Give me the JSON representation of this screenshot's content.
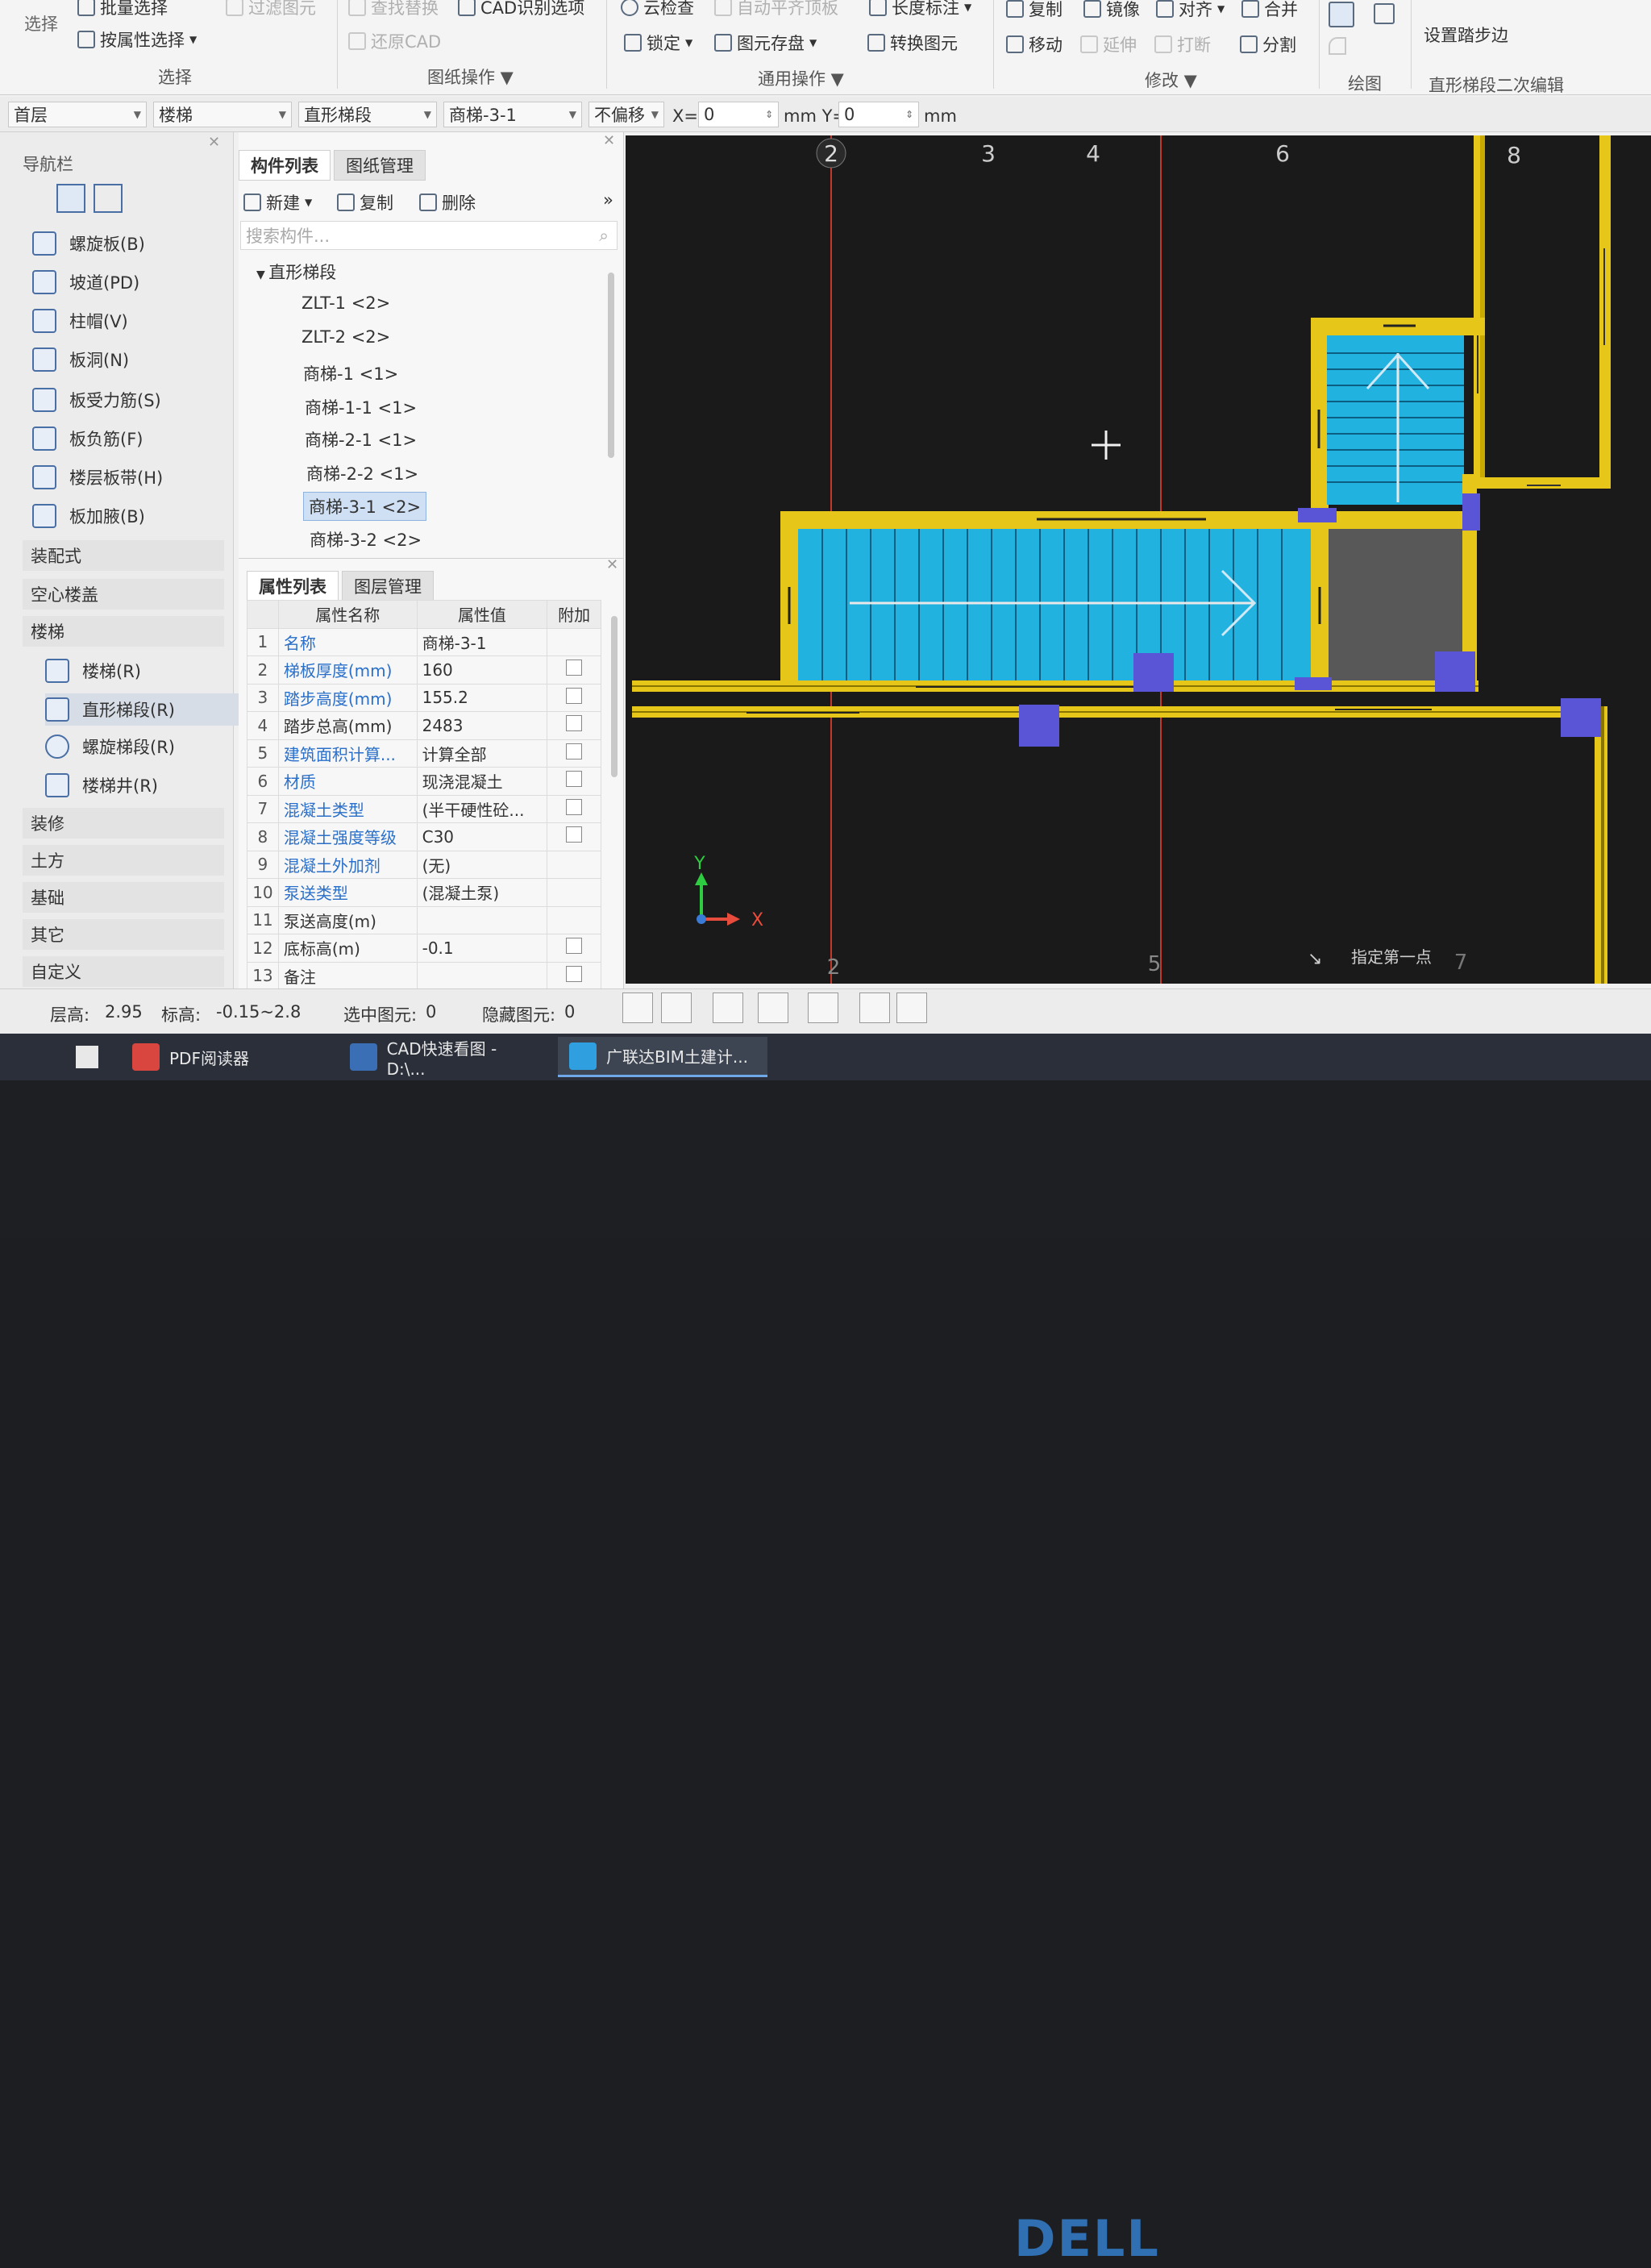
{
  "ribbon": {
    "select_label": "选择",
    "batch_select": "批量选择",
    "attr_select": "按属性选择",
    "filter_elem": "过滤图元",
    "find_replace": "查找替换",
    "cad_options": "CAD识别选项",
    "restore_cad": "还原CAD",
    "cloud_check": "云检查",
    "auto_flush": "自动平齐顶板",
    "length_dim": "长度标注",
    "lock": "锁定",
    "elem_save": "图元存盘",
    "convert_elem": "转换图元",
    "copy": "复制",
    "mirror": "镜像",
    "align": "对齐",
    "merge": "合并",
    "move": "移动",
    "extend": "延伸",
    "break": "打断",
    "split": "分割",
    "set_step_edge": "设置踏步边",
    "groups": {
      "select": "选择",
      "drawing_ops": "图纸操作",
      "general_ops": "通用操作",
      "modify": "修改",
      "draw": "绘图",
      "stair_edit": "直形梯段二次编辑"
    }
  },
  "combobar": {
    "floor": "首层",
    "category": "楼梯",
    "type": "直形梯段",
    "component": "商梯-3-1",
    "offset": "不偏移",
    "x_label": "X=",
    "x_value": "0",
    "x_unit_y": "mm Y=",
    "y_value": "0",
    "y_unit": "mm"
  },
  "nav": {
    "title": "导航栏",
    "items": [
      {
        "label": "螺旋板(B)"
      },
      {
        "label": "坡道(PD)"
      },
      {
        "label": "柱帽(V)"
      },
      {
        "label": "板洞(N)"
      },
      {
        "label": "板受力筋(S)"
      },
      {
        "label": "板负筋(F)"
      },
      {
        "label": "楼层板带(H)"
      },
      {
        "label": "板加腋(B)"
      }
    ],
    "sections": {
      "prefab": "装配式",
      "hollow": "空心楼盖",
      "stairs": "楼梯",
      "decor": "装修",
      "earth": "土方",
      "foundation": "基础",
      "other": "其它",
      "custom": "自定义"
    },
    "stair_items": [
      {
        "label": "楼梯(R)"
      },
      {
        "label": "直形梯段(R)"
      },
      {
        "label": "螺旋梯段(R)"
      },
      {
        "label": "楼梯井(R)"
      }
    ]
  },
  "components": {
    "tab_list": "构件列表",
    "tab_drawings": "图纸管理",
    "new": "新建",
    "copy": "复制",
    "delete": "删除",
    "search_placeholder": "搜索构件...",
    "tree_root": "直形梯段",
    "items": [
      "ZLT-1 <2>",
      "ZLT-2 <2>",
      "商梯-1 <1>",
      "商梯-1-1 <1>",
      "商梯-2-1 <1>",
      "商梯-2-2 <1>",
      "商梯-3-1 <2>",
      "商梯-3-2 <2>"
    ],
    "selected": "商梯-3-1 <2>"
  },
  "properties": {
    "tab_props": "属性列表",
    "tab_layers": "图层管理",
    "col_name": "属性名称",
    "col_value": "属性值",
    "col_extra": "附加",
    "rows": [
      {
        "num": "1",
        "name": "名称",
        "value": "商梯-3-1"
      },
      {
        "num": "2",
        "name": "梯板厚度(mm)",
        "value": "160"
      },
      {
        "num": "3",
        "name": "踏步高度(mm)",
        "value": "155.2"
      },
      {
        "num": "4",
        "name": "踏步总高(mm)",
        "value": "2483"
      },
      {
        "num": "5",
        "name": "建筑面积计算...",
        "value": "计算全部"
      },
      {
        "num": "6",
        "name": "材质",
        "value": "现浇混凝土"
      },
      {
        "num": "7",
        "name": "混凝土类型",
        "value": "(半干硬性砼..."
      },
      {
        "num": "8",
        "name": "混凝土强度等级",
        "value": "C30"
      },
      {
        "num": "9",
        "name": "混凝土外加剂",
        "value": "(无)"
      },
      {
        "num": "10",
        "name": "泵送类型",
        "value": "(混凝土泵)"
      },
      {
        "num": "11",
        "name": "泵送高度(m)",
        "value": ""
      },
      {
        "num": "12",
        "name": "底标高(m)",
        "value": "-0.1"
      },
      {
        "num": "13",
        "name": "备注",
        "value": ""
      }
    ]
  },
  "canvas": {
    "axis_top": [
      "2",
      "3",
      "4",
      "6",
      "8"
    ],
    "axis_bottom": [
      "2",
      "5",
      "7"
    ],
    "hint": "指定第一点",
    "axis_x": "X",
    "axis_y": "Y",
    "colors": {
      "background": "#1a1a1a",
      "wall": "#e6c619",
      "stair": "#22b2e0",
      "grid": "#c0392b",
      "column": "#5a55d6"
    }
  },
  "status": {
    "floor_height_label": "层高:",
    "floor_height": "2.95",
    "elevation_label": "标高:",
    "elevation": "-0.15~2.8",
    "selected_label": "选中图元:",
    "selected": "0",
    "hidden_label": "隐藏图元:",
    "hidden": "0"
  },
  "taskbar": {
    "items": [
      {
        "label": "PDF阅读器"
      },
      {
        "label": "CAD快速看图 - D:\\..."
      },
      {
        "label": "广联达BIM土建计..."
      }
    ]
  },
  "brand": "DELL"
}
